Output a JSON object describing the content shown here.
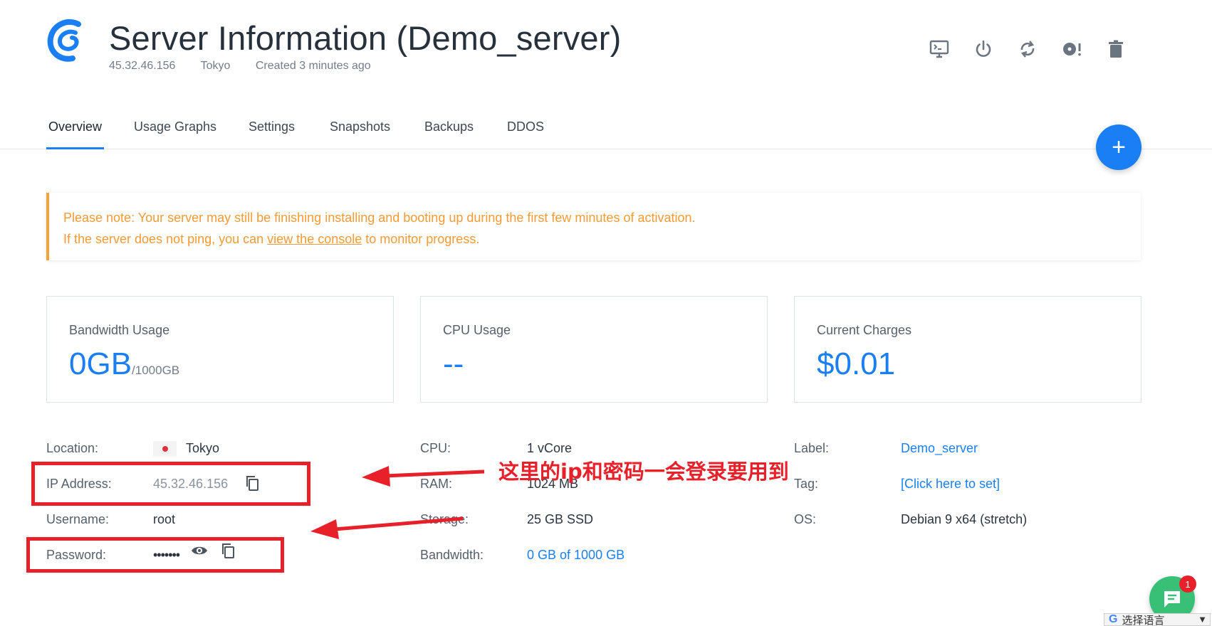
{
  "header": {
    "title": "Server Information (Demo_server)",
    "ip": "45.32.46.156",
    "location": "Tokyo",
    "created": "Created 3 minutes ago",
    "actions": [
      "console-icon",
      "power-icon",
      "restart-icon",
      "reinstall-icon",
      "trash-icon"
    ]
  },
  "tabs": [
    "Overview",
    "Usage Graphs",
    "Settings",
    "Snapshots",
    "Backups",
    "DDOS"
  ],
  "fab": {
    "label": "+"
  },
  "notice": {
    "line1": "Please note: Your server may still be finishing installing and booting up during the first few minutes of activation.",
    "line2_prefix": "If the server does not ping, you can ",
    "line2_link": "view the console",
    "line2_suffix": " to monitor progress."
  },
  "cards": {
    "bandwidth": {
      "label": "Bandwidth Usage",
      "value": "0GB",
      "unit": "/1000GB"
    },
    "cpu": {
      "label": "CPU Usage",
      "value": "--"
    },
    "charges": {
      "label": "Current Charges",
      "value": "$0.01"
    }
  },
  "details": {
    "col1": {
      "location_label": "Location:",
      "location_value": "Tokyo",
      "ip_label": "IP Address:",
      "ip_value": "45.32.46.156",
      "username_label": "Username:",
      "username_value": "root",
      "password_label": "Password:",
      "password_value": "•••••••"
    },
    "col2": {
      "cpu_label": "CPU:",
      "cpu_value": "1 vCore",
      "ram_label": "RAM:",
      "ram_value": "1024 MB",
      "storage_label": "Storage:",
      "storage_value": "25 GB SSD",
      "bandwidth_label": "Bandwidth:",
      "bandwidth_value": "0 GB of 1000 GB"
    },
    "col3": {
      "label_label": "Label:",
      "label_value": "Demo_server",
      "tag_label": "Tag:",
      "tag_value": "[Click here to set]",
      "os_label": "OS:",
      "os_value": "Debian 9 x64 (stretch)"
    }
  },
  "annotation": {
    "text": "这里的ip和密码一会登录要用到",
    "color": "#e8202a"
  },
  "chat": {
    "badge": "1"
  },
  "translate": {
    "g": "G",
    "label": "选择语言",
    "caret": "▼"
  },
  "colors": {
    "accent": "#1a7ff5",
    "warning": "#f7a33a",
    "annotation": "#e8202a",
    "chat": "#38c077"
  }
}
